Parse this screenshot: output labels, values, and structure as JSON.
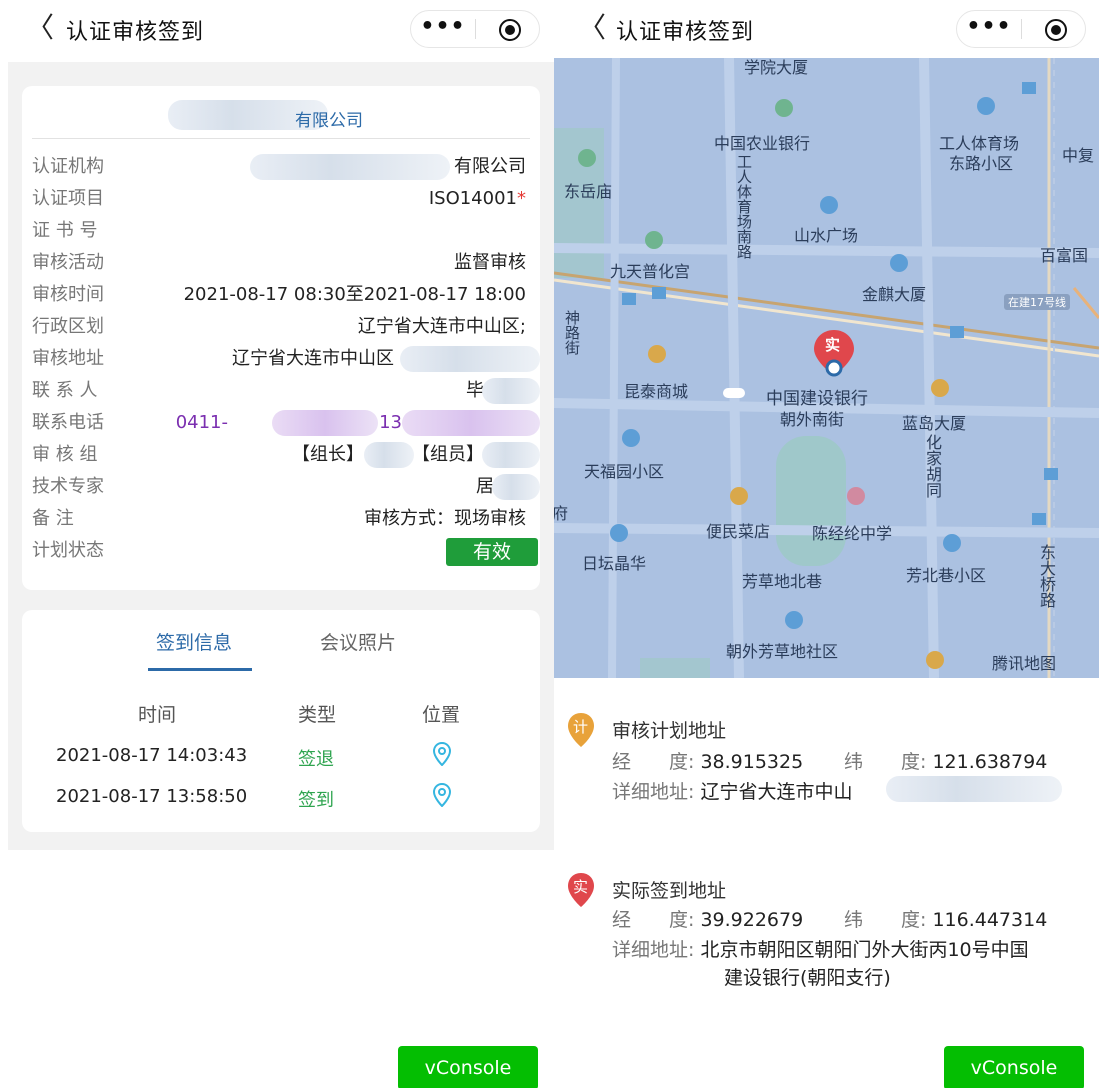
{
  "left": {
    "nav": {
      "back": "〈",
      "title": "认证审核签到",
      "more": "•••"
    },
    "company_suffix": "有限公司",
    "rows": [
      {
        "label": "认证机构",
        "value": "有限公司"
      },
      {
        "label": "认证项目",
        "value": "ISO14001",
        "star": "*"
      },
      {
        "label": "证 书 号",
        "value": ""
      },
      {
        "label": "审核活动",
        "value": "监督审核"
      },
      {
        "label": "审核时间",
        "value": "2021-08-17 08:30至2021-08-17 18:00"
      },
      {
        "label": "行政区划",
        "value": "辽宁省大连市中山区;"
      },
      {
        "label": "审核地址",
        "value": "辽宁省大连市中山区"
      },
      {
        "label": "联 系 人",
        "value": "毕"
      },
      {
        "label": "联系电话",
        "value_a": "0411-",
        "value_b": "13"
      },
      {
        "label": "审 核 组",
        "value_a": "【组长】",
        "value_b": "【组员】"
      },
      {
        "label": "技术专家",
        "value": "居"
      },
      {
        "label": "备 注",
        "value": "审核方式：现场审核"
      },
      {
        "label": "计划状态",
        "value": "有效"
      }
    ],
    "tabs": {
      "active": "签到信息",
      "other": "会议照片"
    },
    "table": {
      "headers": [
        "时间",
        "类型",
        "位置"
      ],
      "rows": [
        {
          "time": "2021-08-17 14:03:43",
          "type": "签退"
        },
        {
          "time": "2021-08-17 13:58:50",
          "type": "签到"
        }
      ]
    },
    "vconsole": "vConsole"
  },
  "right": {
    "nav": {
      "back": "〈",
      "title": "认证审核签到",
      "more": "•••"
    },
    "map": {
      "pois": [
        "学院大厦",
        "中国农业银行",
        "工人体育场",
        "东路小区",
        "中复",
        "东岳庙",
        "工人体育场南路",
        "山水广场",
        "百富国",
        "九天普化宫",
        "金麒大厦",
        "在建17号线",
        "神路街",
        "昆泰商城",
        "中国建设银行",
        "朝外南街",
        "蓝岛大厦",
        "化家胡同",
        "天福园小区",
        "政府",
        "便民菜店",
        "陈经纶中学",
        "日坛晶华",
        "芳草地北巷",
        "芳北巷小区",
        "东大桥路",
        "朝外芳草地社区",
        "腾讯地图"
      ],
      "marker_label": "实"
    },
    "plan": {
      "icon": "计",
      "title": "审核计划地址",
      "lng_label": "经　　度:",
      "lng": "38.915325",
      "lat_label": "纬　　度:",
      "lat": "121.638794",
      "addr_label": "详细地址:",
      "addr": "辽宁省大连市中山"
    },
    "actual": {
      "icon": "实",
      "title": "实际签到地址",
      "lng_label": "经　　度:",
      "lng": "39.922679",
      "lat_label": "纬　　度:",
      "lat": "116.447314",
      "addr_label": "详细地址:",
      "addr_line1": "北京市朝阳区朝阳门外大街丙10号中国",
      "addr_line2": "建设银行(朝阳支行)"
    },
    "vconsole": "vConsole"
  },
  "colors": {
    "accent": "#2c6aa8",
    "status_green": "#1f9d3a",
    "vconsole_green": "#04be02",
    "signin_green": "#2ea44f"
  }
}
